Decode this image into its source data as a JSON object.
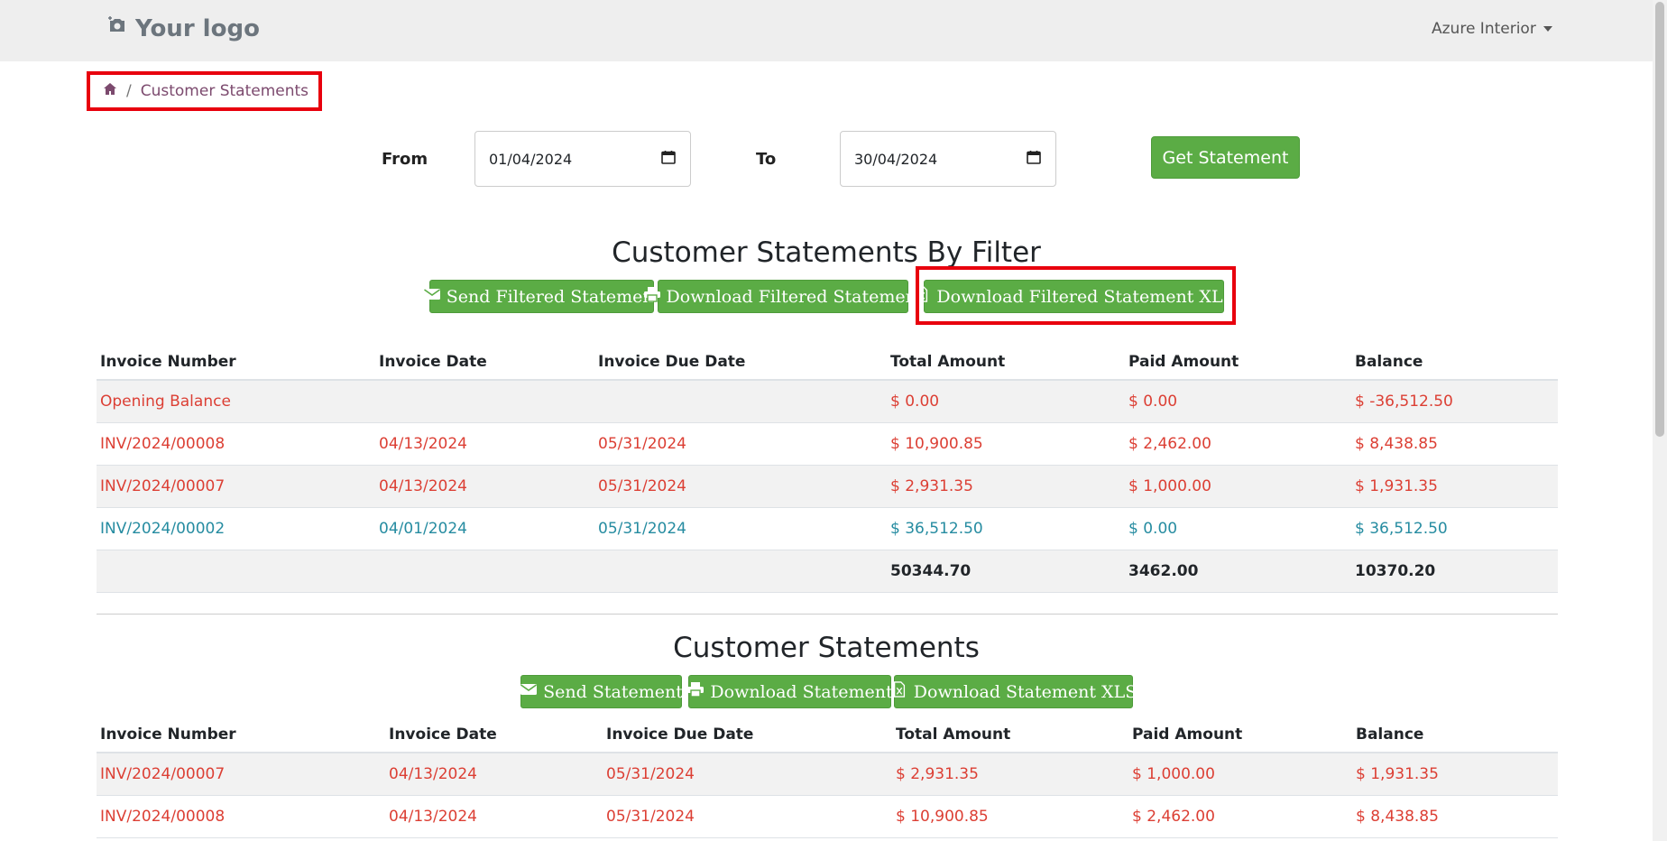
{
  "navbar": {
    "logo_text": "Your logo",
    "user_name": "Azure Interior"
  },
  "breadcrumb": {
    "current": "Customer Statements"
  },
  "filter": {
    "from_label": "From",
    "from_value": "01/04/2024",
    "to_label": "To",
    "to_value": "30/04/2024",
    "get_button": "Get Statement"
  },
  "filtered_section": {
    "title": "Customer Statements By Filter",
    "send_button": "Send Filtered Statement",
    "download_button": "Download Filtered Statement",
    "download_xls_button": "Download Filtered Statement XLS",
    "headers": [
      "Invoice Number",
      "Invoice Date",
      "Invoice Due Date",
      "Total Amount",
      "Paid Amount",
      "Balance"
    ],
    "rows": [
      {
        "style": "red",
        "cells": [
          "Opening Balance",
          "",
          "",
          "$ 0.00",
          "$ 0.00",
          "$ -36,512.50"
        ]
      },
      {
        "style": "red",
        "cells": [
          "INV/2024/00008",
          "04/13/2024",
          "05/31/2024",
          "$ 10,900.85",
          "$ 2,462.00",
          "$ 8,438.85"
        ]
      },
      {
        "style": "red",
        "cells": [
          "INV/2024/00007",
          "04/13/2024",
          "05/31/2024",
          "$ 2,931.35",
          "$ 1,000.00",
          "$ 1,931.35"
        ]
      },
      {
        "style": "blue",
        "cells": [
          "INV/2024/00002",
          "04/01/2024",
          "05/31/2024",
          "$ 36,512.50",
          "$ 0.00",
          "$ 36,512.50"
        ]
      }
    ],
    "totals": [
      "",
      "",
      "",
      "50344.70",
      "3462.00",
      "10370.20"
    ]
  },
  "all_section": {
    "title": "Customer Statements",
    "send_button": "Send Statement",
    "download_button": "Download Statement",
    "download_xls_button": "Download Statement XLS",
    "headers": [
      "Invoice Number",
      "Invoice Date",
      "Invoice Due Date",
      "Total Amount",
      "Paid Amount",
      "Balance"
    ],
    "rows": [
      {
        "style": "red",
        "cells": [
          "INV/2024/00007",
          "04/13/2024",
          "05/31/2024",
          "$ 2,931.35",
          "$ 1,000.00",
          "$ 1,931.35"
        ]
      },
      {
        "style": "red",
        "cells": [
          "INV/2024/00008",
          "04/13/2024",
          "05/31/2024",
          "$ 10,900.85",
          "$ 2,462.00",
          "$ 8,438.85"
        ]
      }
    ]
  },
  "colors": {
    "accent_green": "#5bac45",
    "overdue_red": "#dc3f34",
    "paid_blue": "#268ca1",
    "highlight_red": "#e8000d"
  },
  "icons": [
    "camera-icon",
    "home-icon",
    "calendar-icon",
    "envelope-icon",
    "print-icon",
    "excel-file-icon"
  ]
}
